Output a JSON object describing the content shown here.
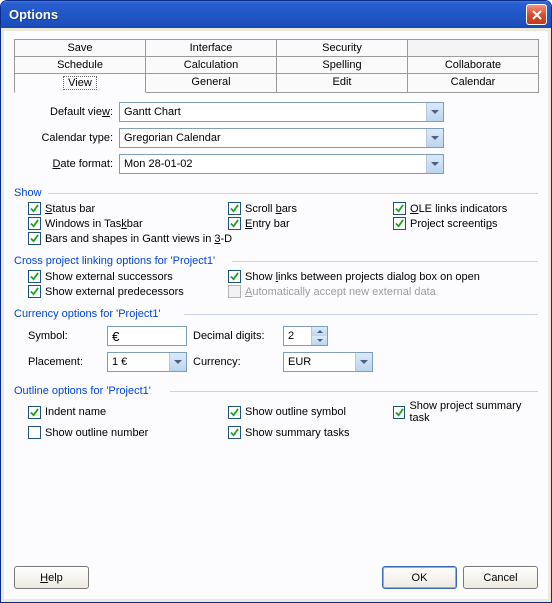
{
  "title": "Options",
  "tabs": {
    "row1": [
      "Save",
      "Interface",
      "Security",
      ""
    ],
    "row2": [
      "Schedule",
      "Calculation",
      "Spelling",
      "Collaborate"
    ],
    "row3": [
      "View",
      "General",
      "Edit",
      "Calendar"
    ]
  },
  "active_tab": "View",
  "fields": {
    "default_view_label_pre": "Default vie",
    "default_view_label_u": "w",
    "default_view_label_post": ":",
    "default_view": "Gantt Chart",
    "calendar_type_label": "Calendar type:",
    "calendar_type": "Gregorian Calendar",
    "date_format_label_u": "D",
    "date_format_label_post": "ate format:",
    "date_format": "Mon 28-01-02"
  },
  "groups": {
    "show": "Show",
    "cross": "Cross project linking options for 'Project1'",
    "currency": "Currency options for 'Project1'",
    "outline": "Outline options for 'Project1'"
  },
  "show": {
    "status_bar": "tatus bar",
    "status_bar_u": "S",
    "scroll_bars_pre": "Scroll ",
    "scroll_bars_u": "b",
    "scroll_bars_post": "ars",
    "ole": "LE links indicators",
    "ole_u": "O",
    "win_taskbar": "Windows in Tas",
    "win_taskbar_u": "k",
    "win_taskbar_post": "bar",
    "entry_bar_u": "E",
    "entry_bar": "ntry bar",
    "screentips_pre": "Project screenti",
    "screentips_u": "p",
    "screentips_post": "s",
    "bars3d_pre": "Bars and shapes in Gantt views in ",
    "bars3d_u": "3",
    "bars3d_post": "-D"
  },
  "cross": {
    "ext_succ": "Show external successors",
    "show_links_pre": "Show ",
    "show_links_u": "l",
    "show_links_post": "inks between projects dialog box on open",
    "ext_pred": "Show external predecessors",
    "auto_accept_u": "A",
    "auto_accept": "utomatically accept new external data"
  },
  "currency": {
    "symbol_label": "Symbol:",
    "symbol": "€",
    "decimal_label": "Decimal digits:",
    "decimal": "2",
    "placement_label": "Placement:",
    "placement": "1 €",
    "currency_label": "Currency:",
    "currency": "EUR"
  },
  "outline": {
    "indent": "Indent name",
    "show_symbol": "Show outline symbol",
    "show_summary": "Show project summary task",
    "show_number": "Show outline number",
    "show_tasks": "Show summary tasks"
  },
  "buttons": {
    "help_u": "H",
    "help": "elp",
    "ok": "OK",
    "cancel": "Cancel"
  }
}
